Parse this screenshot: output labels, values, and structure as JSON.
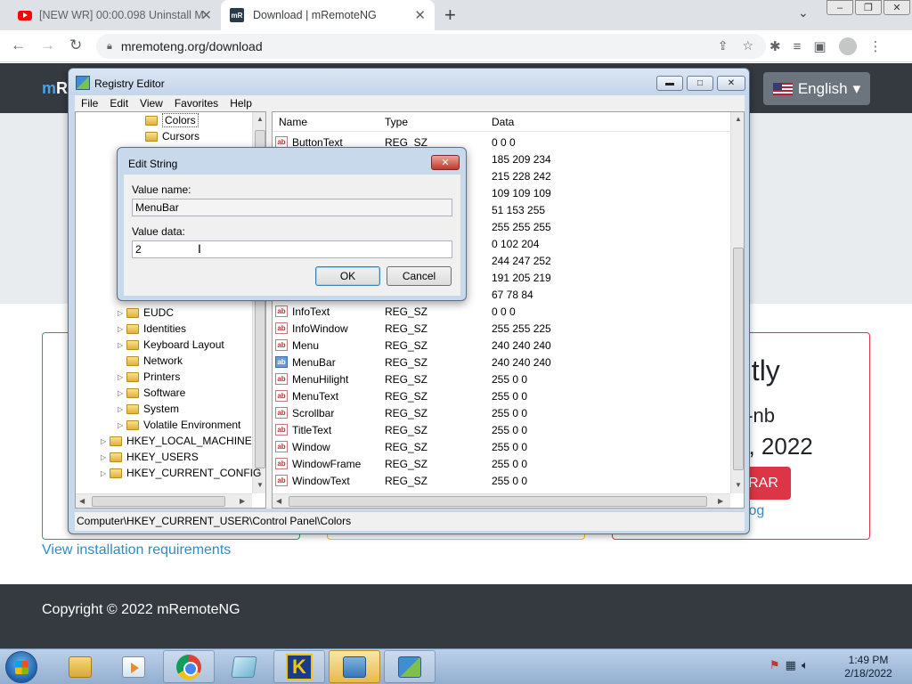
{
  "browser": {
    "tabs": [
      {
        "title": "[NEW WR] 00:00.098 Uninstall M",
        "active": false
      },
      {
        "title": "Download | mRemoteNG",
        "active": true
      }
    ],
    "url": "mremoteng.org/download"
  },
  "site": {
    "brand_initial": "m",
    "brand_rest": "R",
    "language": "English",
    "card_heading": "ntly",
    "card_sub": "2-nb",
    "card_date": "7, 2022",
    "card_button": "RAR",
    "card_link": "elog",
    "requirements_link": "View installation requirements",
    "copyright": "Copyright © 2022 mRemoteNG"
  },
  "regedit": {
    "title": "Registry Editor",
    "menu": [
      "File",
      "Edit",
      "View",
      "Favorites",
      "Help"
    ],
    "tree": [
      {
        "label": "Colors",
        "indent": 3,
        "arrow": false
      },
      {
        "label": "Cursors",
        "indent": 3,
        "arrow": false
      },
      {
        "label": "EUDC",
        "indent": 2,
        "arrow": true
      },
      {
        "label": "Identities",
        "indent": 2,
        "arrow": true
      },
      {
        "label": "Keyboard Layout",
        "indent": 2,
        "arrow": true
      },
      {
        "label": "Network",
        "indent": 2,
        "arrow": false
      },
      {
        "label": "Printers",
        "indent": 2,
        "arrow": true
      },
      {
        "label": "Software",
        "indent": 2,
        "arrow": true
      },
      {
        "label": "System",
        "indent": 2,
        "arrow": true
      },
      {
        "label": "Volatile Environment",
        "indent": 2,
        "arrow": true
      },
      {
        "label": "HKEY_LOCAL_MACHINE",
        "indent": 1,
        "arrow": true
      },
      {
        "label": "HKEY_USERS",
        "indent": 1,
        "arrow": true
      },
      {
        "label": "HKEY_CURRENT_CONFIG",
        "indent": 1,
        "arrow": true
      }
    ],
    "columns": {
      "name": "Name",
      "type": "Type",
      "data": "Data"
    },
    "rows": [
      {
        "name": "ButtonText",
        "type": "REG_SZ",
        "data": "0 0 0"
      },
      {
        "name": "",
        "type": "",
        "data": "185 209 234"
      },
      {
        "name": "",
        "type": "",
        "data": "215 228 242"
      },
      {
        "name": "",
        "type": "",
        "data": "109 109 109"
      },
      {
        "name": "",
        "type": "",
        "data": "51 153 255"
      },
      {
        "name": "",
        "type": "",
        "data": "255 255 255"
      },
      {
        "name": "",
        "type": "",
        "data": "0 102 204"
      },
      {
        "name": "",
        "type": "",
        "data": "244 247 252"
      },
      {
        "name": "",
        "type": "",
        "data": "191 205 219"
      },
      {
        "name": "",
        "type": "",
        "data": "67 78 84"
      },
      {
        "name": "InfoText",
        "type": "REG_SZ",
        "data": "0 0 0"
      },
      {
        "name": "InfoWindow",
        "type": "REG_SZ",
        "data": "255 255 225"
      },
      {
        "name": "Menu",
        "type": "REG_SZ",
        "data": "240 240 240"
      },
      {
        "name": "MenuBar",
        "type": "REG_SZ",
        "data": "240 240 240",
        "selected": true
      },
      {
        "name": "MenuHilight",
        "type": "REG_SZ",
        "data": "255 0 0"
      },
      {
        "name": "MenuText",
        "type": "REG_SZ",
        "data": "255 0 0"
      },
      {
        "name": "Scrollbar",
        "type": "REG_SZ",
        "data": "255 0 0"
      },
      {
        "name": "TitleText",
        "type": "REG_SZ",
        "data": "255 0 0"
      },
      {
        "name": "Window",
        "type": "REG_SZ",
        "data": "255 0 0"
      },
      {
        "name": "WindowFrame",
        "type": "REG_SZ",
        "data": "255 0 0"
      },
      {
        "name": "WindowText",
        "type": "REG_SZ",
        "data": "255 0 0"
      }
    ],
    "status": "Computer\\HKEY_CURRENT_USER\\Control Panel\\Colors"
  },
  "dialog": {
    "title": "Edit String",
    "value_name_label": "Value name:",
    "value_name": "MenuBar",
    "value_data_label": "Value data:",
    "value_data": "2",
    "ok": "OK",
    "cancel": "Cancel"
  },
  "taskbar": {
    "apps": [
      "windows-explorer",
      "media-player",
      "google-chrome",
      "notepad",
      "k-app",
      "network-app",
      "registry-editor"
    ],
    "time": "1:49 PM",
    "date": "2/18/2022"
  }
}
